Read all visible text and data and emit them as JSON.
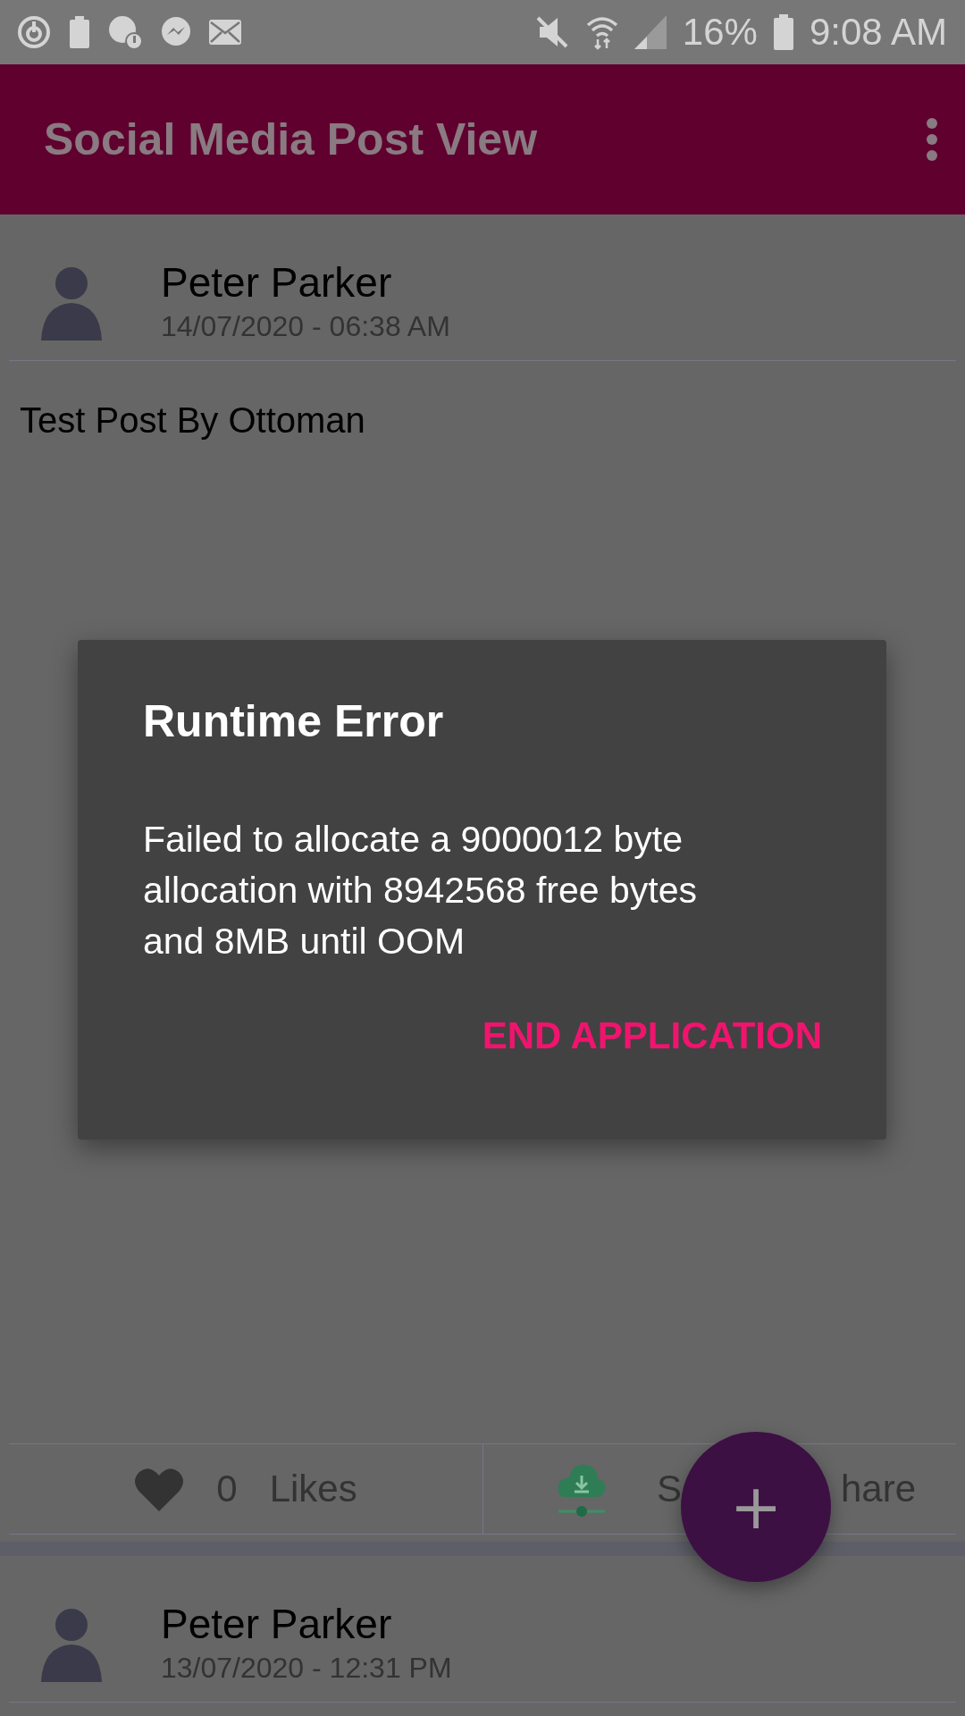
{
  "status_bar": {
    "battery": "16%",
    "time": "9:08 AM"
  },
  "app_bar": {
    "title": "Social Media Post View"
  },
  "posts": [
    {
      "author": "Peter Parker",
      "date": "14/07/2020 - 06:38 AM",
      "text": "Test Post By Ottoman",
      "likes_count": "0",
      "likes_label": "Likes",
      "share_label_parts": [
        "S",
        "hare"
      ]
    },
    {
      "author": "Peter Parker",
      "date": "13/07/2020 - 12:31 PM"
    }
  ],
  "dialog": {
    "title": "Runtime Error",
    "message": "Failed to allocate a 9000012 byte allocation with 8942568 free bytes and 8MB until OOM",
    "button": "END APPLICATION"
  },
  "fab": {
    "label": "+"
  }
}
